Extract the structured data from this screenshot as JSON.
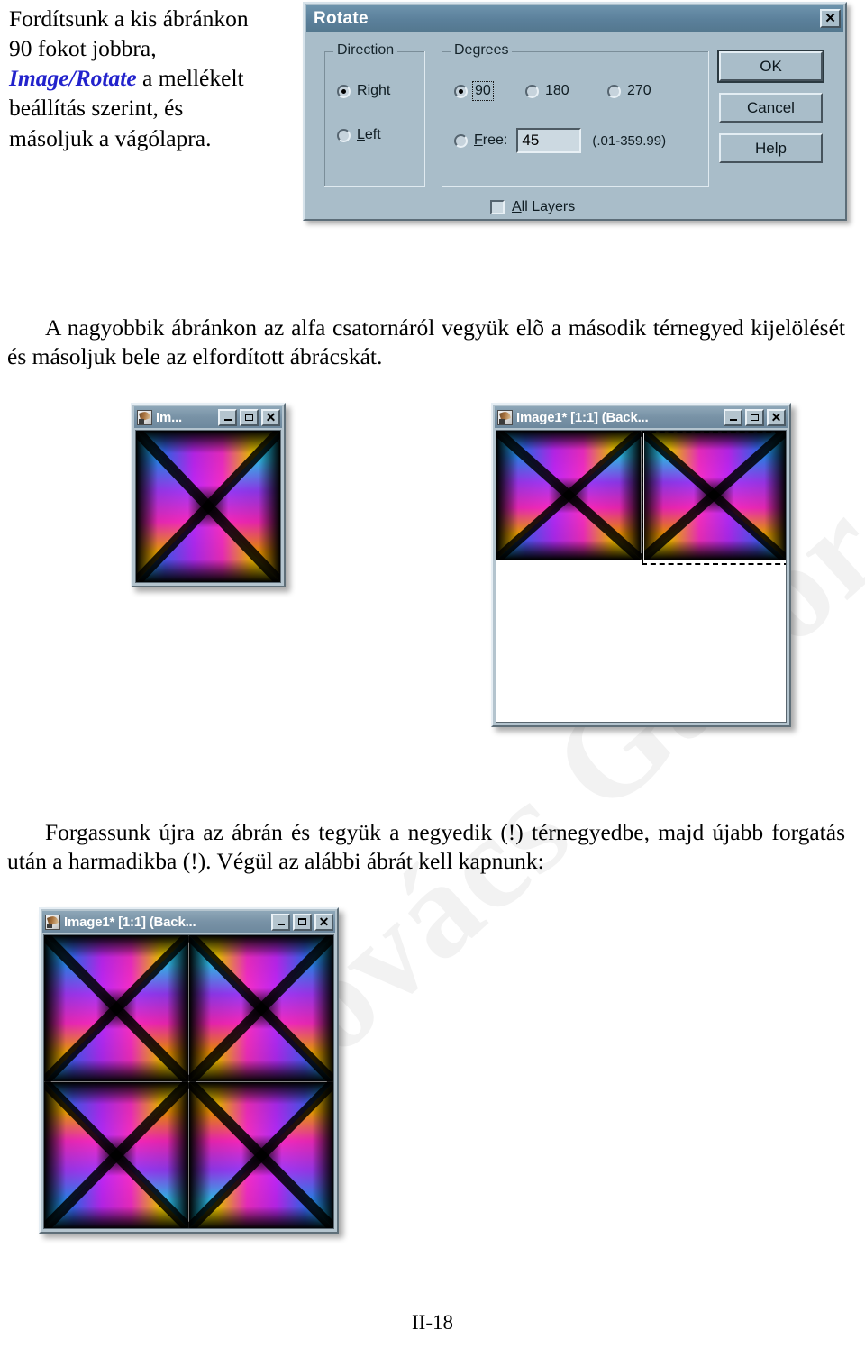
{
  "page": {
    "number": "II-18",
    "watermark": "Kovács Gábor"
  },
  "intro": {
    "line1": "Fordítsunk a kis ábránkon",
    "line2": "90 fokot jobbra,",
    "emphasis": "Image/Rotate",
    "line3_rest": " a mellékelt",
    "line4": "beállítás szerint, és",
    "line5": "másoljuk a vágólapra."
  },
  "dialog": {
    "title": "Rotate",
    "close_label": "✕",
    "direction": {
      "legend": "Direction",
      "options": [
        {
          "label": "Right",
          "mnemonic": "R",
          "rest": "ight",
          "checked": true
        },
        {
          "label": "Left",
          "mnemonic": "L",
          "rest": "eft",
          "checked": false
        }
      ]
    },
    "degrees": {
      "legend": "Degrees",
      "options": [
        {
          "label": "90",
          "mnemonic": "9",
          "rest": "0",
          "checked": true,
          "focused": true
        },
        {
          "label": "180",
          "mnemonic": "1",
          "rest": "80",
          "checked": false,
          "focused": false
        },
        {
          "label": "270",
          "mnemonic": "2",
          "rest": "70",
          "checked": false,
          "focused": false
        }
      ],
      "free": {
        "label_mnemonic": "F",
        "label_rest": "ree:",
        "value": "45",
        "range_hint": "(.01-359.99)",
        "checked": false
      }
    },
    "all_layers": {
      "label_mnemonic": "A",
      "label_rest": "ll Layers",
      "checked": false
    },
    "buttons": [
      {
        "label": "OK",
        "default": true
      },
      {
        "label": "Cancel",
        "default": false
      },
      {
        "label": "Help",
        "default": false
      }
    ]
  },
  "para1": "A nagyobbik ábránkon az alfa csatornáról vegyük elõ a második térnegyed kijelölését és másoljuk bele az elfordított ábrácskát.",
  "para2": "Forgassunk újra az ábrán és tegyük a negyedik (!) térnegyedbe, majd újabb forgatás után a harmadikba (!). Végül az alábbi ábrát kell kapnunk:",
  "windows": {
    "small": {
      "title": "Im...",
      "min_label": "_",
      "max_label": "□",
      "close_label": "✕"
    },
    "large": {
      "title": "Image1* [1:1] (Back...",
      "min_label": "_",
      "max_label": "□",
      "close_label": "✕"
    },
    "final": {
      "title": "Image1* [1:1] (Back...",
      "min_label": "_",
      "max_label": "□",
      "close_label": "✕"
    }
  }
}
